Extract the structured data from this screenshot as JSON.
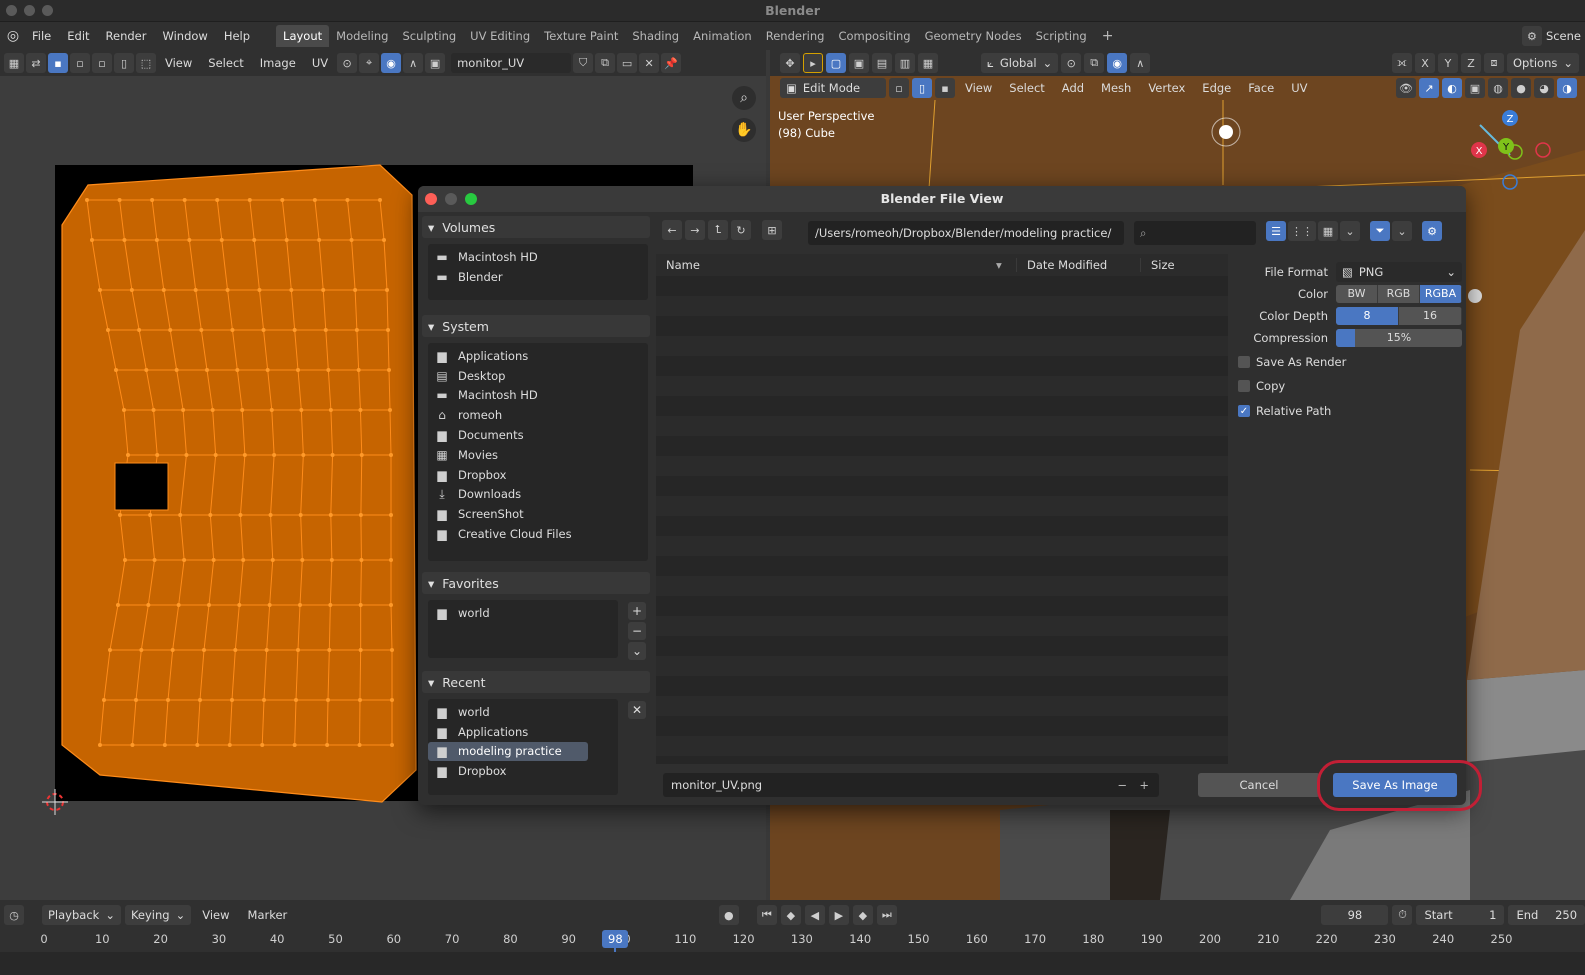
{
  "app": {
    "title": "Blender"
  },
  "menu": [
    "File",
    "Edit",
    "Render",
    "Window",
    "Help"
  ],
  "tabs": [
    "Layout",
    "Modeling",
    "Sculpting",
    "UV Editing",
    "Texture Paint",
    "Shading",
    "Animation",
    "Rendering",
    "Compositing",
    "Geometry Nodes",
    "Scripting",
    "+"
  ],
  "active_tab": "Layout",
  "topright": {
    "scene": "Scene"
  },
  "uv_editor": {
    "menus": [
      "View",
      "Select",
      "Image",
      "UV"
    ],
    "image_name": "monitor_UV"
  },
  "viewport": {
    "orientation": "Global",
    "options": "Options",
    "mode": "Edit Mode",
    "menus": [
      "View",
      "Select",
      "Add",
      "Mesh",
      "Vertex",
      "Edge",
      "Face",
      "UV"
    ],
    "info_line1": "User Perspective",
    "info_line2": "(98) Cube",
    "axes": {
      "x": "X",
      "y": "Y",
      "z": "Z"
    },
    "xyz": [
      "X",
      "Y",
      "Z"
    ]
  },
  "dialog": {
    "title": "Blender File View",
    "path": "/Users/romeoh/Dropbox/Blender/modeling practice/",
    "sections": {
      "volumes": {
        "title": "Volumes",
        "items": [
          "Macintosh HD",
          "Blender"
        ]
      },
      "system": {
        "title": "System",
        "items": [
          "Applications",
          "Desktop",
          "Macintosh HD",
          "romeoh",
          "Documents",
          "Movies",
          "Dropbox",
          "Downloads",
          "ScreenShot",
          "Creative Cloud Files"
        ]
      },
      "favorites": {
        "title": "Favorites",
        "items": [
          "world"
        ]
      },
      "recent": {
        "title": "Recent",
        "items": [
          "world",
          "Applications",
          "modeling practice",
          "Dropbox"
        ],
        "selected": "modeling practice"
      }
    },
    "columns": {
      "name": "Name",
      "date": "Date Modified",
      "size": "Size"
    },
    "props": {
      "file_format_label": "File Format",
      "file_format": "PNG",
      "color_label": "Color",
      "color_options": [
        "BW",
        "RGB",
        "RGBA"
      ],
      "color_selected": "RGBA",
      "depth_label": "Color Depth",
      "depth_options": [
        "8",
        "16"
      ],
      "depth_selected": "8",
      "compression_label": "Compression",
      "compression": "15%",
      "compression_value": 15,
      "save_as_render": "Save As Render",
      "save_as_render_checked": false,
      "copy": "Copy",
      "copy_checked": false,
      "relative_path": "Relative Path",
      "relative_path_checked": true
    },
    "filename": "monitor_UV.png",
    "cancel": "Cancel",
    "save": "Save As Image"
  },
  "timeline": {
    "menus": [
      "Playback",
      "Keying",
      "View",
      "Marker"
    ],
    "current_frame": "98",
    "start_label": "Start",
    "start": "1",
    "end_label": "End",
    "end": "250",
    "ticks": [
      "0",
      "10",
      "20",
      "30",
      "40",
      "50",
      "60",
      "70",
      "80",
      "90",
      "0",
      "110",
      "120",
      "130",
      "140",
      "150",
      "160",
      "170",
      "180",
      "190",
      "200",
      "210",
      "220",
      "230",
      "240",
      "250"
    ],
    "playhead_frame": "98"
  },
  "colors": {
    "accent": "#4a77c2",
    "uv_mesh": "#c66400",
    "uv_edge": "#ff8c1a",
    "highlight": "#c21f35"
  }
}
